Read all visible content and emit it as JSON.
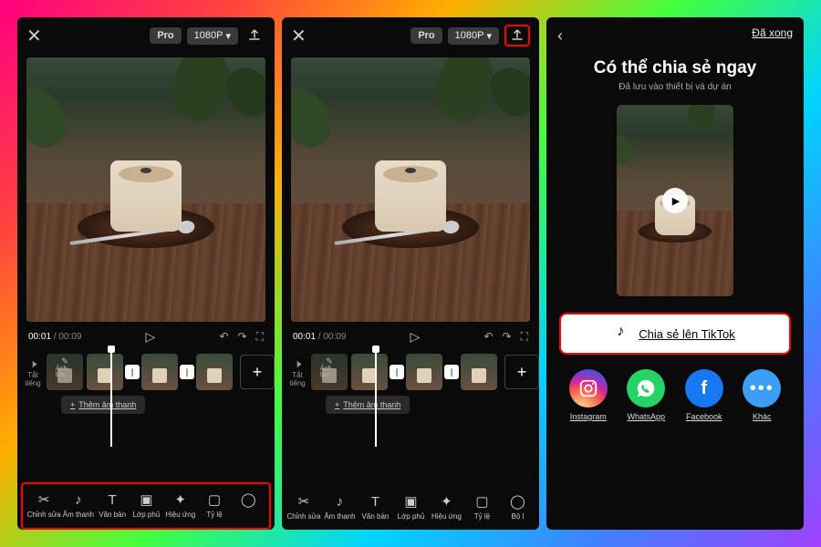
{
  "header": {
    "pro": "Pro",
    "resolution": "1080P"
  },
  "time": {
    "current": "00:01",
    "total": "00:09"
  },
  "timeline": {
    "mute": "Tắt tiếng",
    "cover": "Ảnh bìa",
    "add_audio": "Thêm âm thanh"
  },
  "tools": [
    {
      "id": "edit",
      "label": "Chỉnh sửa"
    },
    {
      "id": "audio",
      "label": "Âm thanh"
    },
    {
      "id": "text",
      "label": "Văn bản"
    },
    {
      "id": "overlay",
      "label": "Lớp phủ"
    },
    {
      "id": "effects",
      "label": "Hiệu ứng"
    },
    {
      "id": "ratio",
      "label": "Tỷ lệ"
    },
    {
      "id": "more",
      "label": "Bộ l"
    }
  ],
  "share": {
    "done": "Đã xong",
    "title": "Có thể chia sẻ ngay",
    "subtitle": "Đã lưu vào thiết bị và dự án",
    "tiktok": "Chia sẻ lên TikTok",
    "apps": [
      {
        "id": "instagram",
        "label": "Instagram"
      },
      {
        "id": "whatsapp",
        "label": "WhatsApp"
      },
      {
        "id": "facebook",
        "label": "Facebook"
      },
      {
        "id": "other",
        "label": "Khác"
      }
    ]
  }
}
